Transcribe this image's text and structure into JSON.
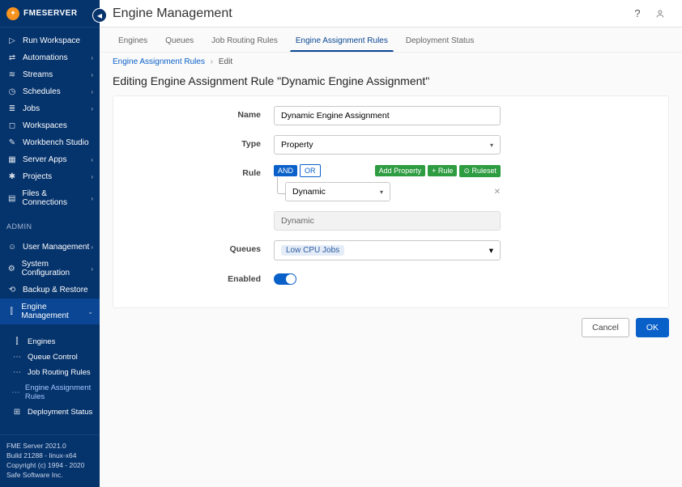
{
  "brand": "FMESERVER",
  "page_title": "Engine Management",
  "sidebar": {
    "items": [
      {
        "icon": "▷",
        "label": "Run Workspace"
      },
      {
        "icon": "⇄",
        "label": "Automations",
        "chev": true
      },
      {
        "icon": "≋",
        "label": "Streams",
        "chev": true
      },
      {
        "icon": "◷",
        "label": "Schedules",
        "chev": true
      },
      {
        "icon": "≣",
        "label": "Jobs",
        "chev": true
      },
      {
        "icon": "◻",
        "label": "Workspaces"
      },
      {
        "icon": "✎",
        "label": "Workbench Studio"
      },
      {
        "icon": "▦",
        "label": "Server Apps",
        "chev": true
      },
      {
        "icon": "✱",
        "label": "Projects",
        "chev": true
      },
      {
        "icon": "▤",
        "label": "Files & Connections",
        "chev": true
      }
    ],
    "admin_label": "ADMIN",
    "admin_items": [
      {
        "icon": "☺",
        "label": "User Management",
        "chev": true
      },
      {
        "icon": "⚙",
        "label": "System Configuration",
        "chev": true
      },
      {
        "icon": "⟲",
        "label": "Backup & Restore"
      },
      {
        "icon": "⫿",
        "label": "Engine Management",
        "chev": true,
        "active": true
      }
    ],
    "sub_items": [
      {
        "icon": "⫿",
        "label": "Engines"
      },
      {
        "icon": "⋯",
        "label": "Queue Control"
      },
      {
        "icon": "⋯",
        "label": "Job Routing Rules"
      },
      {
        "icon": "⋯",
        "label": "Engine Assignment Rules",
        "active": true
      },
      {
        "icon": "⊞",
        "label": "Deployment Status"
      }
    ]
  },
  "footer": {
    "l1": "FME Server 2021.0",
    "l2": "Build 21288 - linux-x64",
    "l3": "Copyright (c) 1994 - 2020",
    "l4": "Safe Software Inc."
  },
  "tabs": [
    "Engines",
    "Queues",
    "Job Routing Rules",
    "Engine Assignment Rules",
    "Deployment Status"
  ],
  "tabs_active_index": 3,
  "breadcrumb": {
    "root": "Engine Assignment Rules",
    "leaf": "Edit"
  },
  "heading": "Editing Engine Assignment Rule \"Dynamic Engine Assignment\"",
  "form": {
    "labels": {
      "name": "Name",
      "type": "Type",
      "rule": "Rule",
      "queues": "Queues",
      "enabled": "Enabled"
    },
    "name_value": "Dynamic Engine Assignment",
    "type_value": "Property",
    "rule": {
      "and": "AND",
      "or": "OR",
      "add_property": "Add Property",
      "add_rule": "+ Rule",
      "add_ruleset": "⊙ Ruleset",
      "property_value": "Dynamic",
      "summary": "Dynamic"
    },
    "queues_chip": "Low CPU Jobs",
    "enabled": true
  },
  "actions": {
    "cancel": "Cancel",
    "ok": "OK"
  }
}
